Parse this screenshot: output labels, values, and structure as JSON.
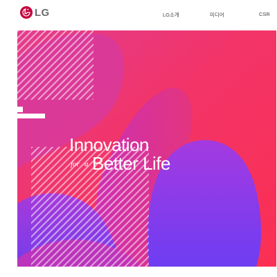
{
  "brand": {
    "name": "LG",
    "logo_icon": "lg-face-logo-icon",
    "color": "#c4003b"
  },
  "nav": {
    "items": [
      {
        "label": "LG소개"
      },
      {
        "label": "미디어"
      },
      {
        "label": "CSR"
      }
    ]
  },
  "hero": {
    "headline_1": "Innovation",
    "sub_for": "for",
    "sub_a": "a",
    "headline_2": "Better Life",
    "colors": {
      "red": "#fb2f52",
      "magenta": "#e23c8e",
      "purple": "#7b3af0",
      "violet": "#b12fd7"
    }
  }
}
